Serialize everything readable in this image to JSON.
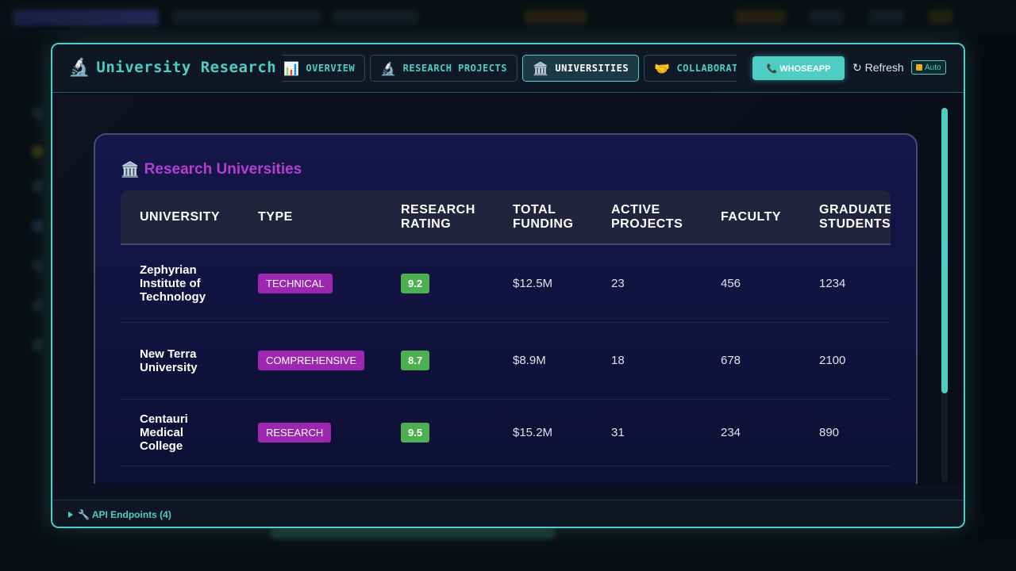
{
  "modal": {
    "title": "University Research",
    "title_icon": "🔬",
    "tabs": [
      {
        "icon": "📊",
        "label": "OVERVIEW"
      },
      {
        "icon": "🔬",
        "label": "RESEARCH PROJECTS"
      },
      {
        "icon": "🏛️",
        "label": "UNIVERSITIES",
        "active": true
      },
      {
        "icon": "🤝",
        "label": "COLLABORATION"
      }
    ],
    "whoseapp_label": "📞 WHOSEAPP",
    "refresh_label": "↻ Refresh",
    "auto_label": "Auto"
  },
  "card": {
    "title_icon": "🏛️",
    "title": "Research Universities"
  },
  "table": {
    "headers": [
      "UNIVERSITY",
      "TYPE",
      "RESEARCH RATING",
      "TOTAL FUNDING",
      "ACTIVE PROJECTS",
      "FACULTY",
      "GRADUATE STUDENTS"
    ],
    "rows": [
      {
        "university": "Zephyrian Institute of Technology",
        "type": "TECHNICAL",
        "rating": "9.2",
        "funding": "$12.5M",
        "projects": "23",
        "faculty": "456",
        "grads": "1234"
      },
      {
        "university": "New Terra University",
        "type": "COMPREHENSIVE",
        "rating": "8.7",
        "funding": "$8.9M",
        "projects": "18",
        "faculty": "678",
        "grads": "2100"
      },
      {
        "university": "Centauri Medical College",
        "type": "RESEARCH",
        "rating": "9.5",
        "funding": "$15.2M",
        "projects": "31",
        "faculty": "234",
        "grads": "890"
      }
    ]
  },
  "footer": {
    "api_label": "🔧 API Endpoints (4)"
  },
  "colors": {
    "accent": "#4ecdc4",
    "type_badge": "#9c27b0",
    "rating_badge": "#4caf50",
    "card_title": "#b43fd0"
  }
}
